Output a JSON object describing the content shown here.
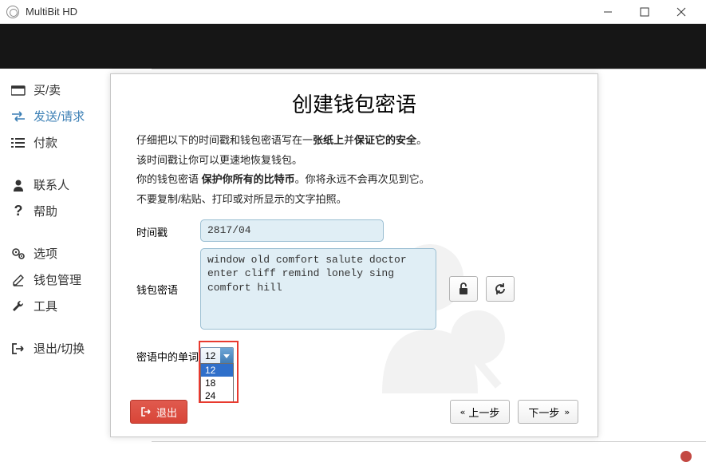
{
  "window": {
    "title": "MultiBit HD"
  },
  "sidebar": {
    "items": [
      {
        "label": "买/卖",
        "icon": "wallet"
      },
      {
        "label": "发送/请求",
        "icon": "exchange",
        "active": true
      },
      {
        "label": "付款",
        "icon": "list"
      },
      {
        "label": "联系人",
        "icon": "user"
      },
      {
        "label": "帮助",
        "icon": "question"
      },
      {
        "label": "选项",
        "icon": "gears"
      },
      {
        "label": "钱包管理",
        "icon": "edit"
      },
      {
        "label": "工具",
        "icon": "wrench"
      },
      {
        "label": "退出/切换",
        "icon": "signout"
      }
    ]
  },
  "modal": {
    "title": "创建钱包密语",
    "instructions": {
      "l1_a": "仔细把以下的时间戳和钱包密语写在一",
      "l1_b": "张纸上",
      "l1_c": "并",
      "l1_d": "保证它的安全",
      "l1_e": "。",
      "l2": "该时间戳让你可以更速地恢复钱包。",
      "l3_a": "你的钱包密语 ",
      "l3_b": "保护你所有的比特币",
      "l3_c": "。你将永远不会再次见到它。",
      "l4": "不要复制/粘贴、打印或对所显示的文字拍照。"
    },
    "labels": {
      "timestamp": "时间戳",
      "phrase": "钱包密语",
      "words": "密语中的单词"
    },
    "values": {
      "timestamp": "2817/04",
      "phrase": "window old comfort salute doctor enter cliff remind lonely sing comfort hill"
    },
    "dropdown": {
      "selected": "12",
      "options": [
        "12",
        "18",
        "24"
      ]
    },
    "buttons": {
      "exit": "退出",
      "prev": "上一步",
      "next": "下一步"
    }
  }
}
